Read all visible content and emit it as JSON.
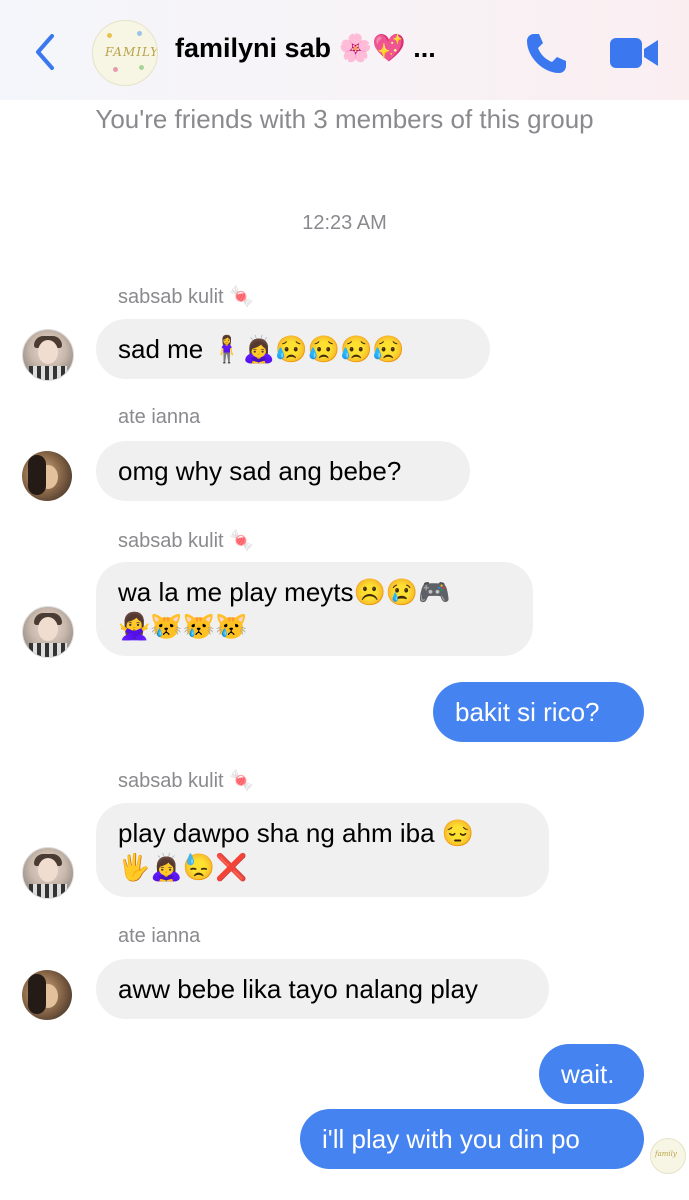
{
  "header": {
    "back_icon": "chevron-left-icon",
    "group_name": "familyni sab 🌸💖 ...",
    "group_avatar_text": "FAMILY",
    "call_icon": "phone-icon",
    "video_icon": "video-camera-icon",
    "accent_color": "#3b78f0"
  },
  "notice": "You're friends with 3 members of this group",
  "timestamp": "12:23 AM",
  "messages": [
    {
      "sender": "sabsab kulit 🍬",
      "text": "sad me 🧍‍♀️🙇‍♀️😥😥😥😥"
    },
    {
      "sender": "ate ianna",
      "text": "omg why sad ang bebe?"
    },
    {
      "sender": "sabsab kulit 🍬",
      "text": "wa la me play meyts☹️😢🎮\n🙅‍♀️😿😿😿"
    },
    {
      "text": "bakit si rico?"
    },
    {
      "sender": "sabsab kulit 🍬",
      "text": "play dawpo sha ng ahm iba 😔\n🖐🙇‍♀️😓❌"
    },
    {
      "sender": "ate ianna",
      "text": "aww bebe lika tayo nalang play"
    },
    {
      "text": "wait."
    },
    {
      "text": "i'll play with you din po"
    }
  ],
  "colors": {
    "outgoing_bubble": "#4583f0",
    "incoming_bubble": "#f0f0f0",
    "secondary_text": "#8a8a8e"
  }
}
